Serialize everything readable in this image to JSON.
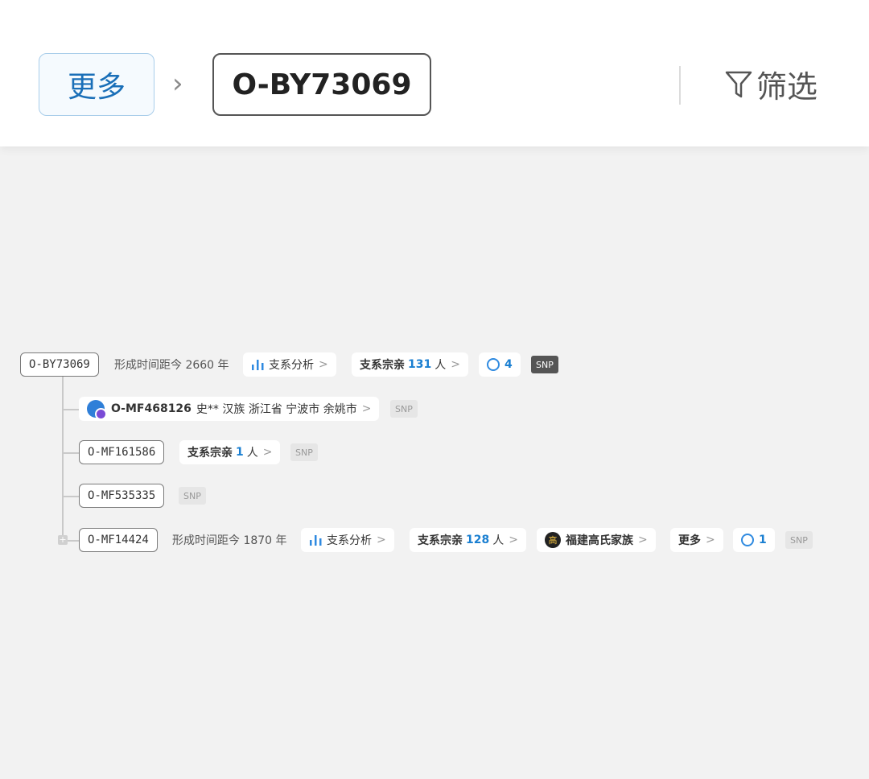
{
  "header": {
    "more_label": "更多",
    "separator": "›",
    "current_label": "O-BY73069",
    "filter_label": "筛选"
  },
  "tree": {
    "root": {
      "id": "O-BY73069",
      "formed": "形成时间距今 2660 年",
      "analysis": "支系分析",
      "kin_prefix": "支系宗亲",
      "kin_count": "131",
      "kin_suffix": "人",
      "comments": "4",
      "snp": "SNP"
    },
    "children": [
      {
        "id": "O-MF468126",
        "detail": "史** 汉族 浙江省 宁波市 余姚市",
        "snp": "SNP"
      },
      {
        "id": "O-MF161586",
        "kin_prefix": "支系宗亲",
        "kin_count": "1",
        "kin_suffix": "人",
        "snp": "SNP"
      },
      {
        "id": "O-MF535335",
        "snp": "SNP"
      },
      {
        "id": "O-MF14424",
        "formed": "形成时间距今 1870 年",
        "analysis": "支系分析",
        "kin_prefix": "支系宗亲",
        "kin_count": "128",
        "kin_suffix": "人",
        "family_icon_char": "高",
        "family": "福建高氏家族",
        "more": "更多",
        "comments": "1",
        "snp": "SNP"
      }
    ],
    "arrow": ">"
  }
}
